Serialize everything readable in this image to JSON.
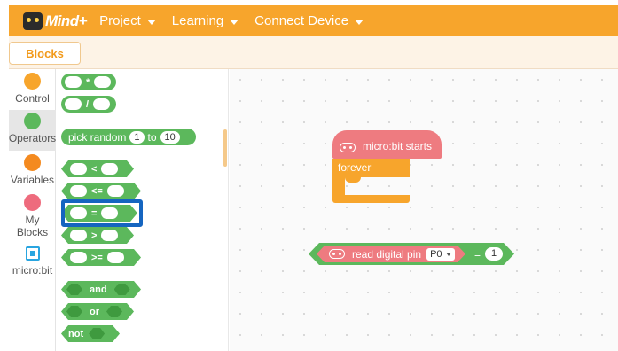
{
  "app": {
    "logo_text": "Mind+",
    "menus": [
      {
        "label": "Project"
      },
      {
        "label": "Learning"
      },
      {
        "label": "Connect Device"
      }
    ],
    "accent_color": "#f7a52c"
  },
  "tabs": {
    "blocks_label": "Blocks"
  },
  "categories": [
    {
      "label": "Control",
      "color": "#f7a52c"
    },
    {
      "label": "Operators",
      "color": "#5cb85c",
      "active": true
    },
    {
      "label": "Variables",
      "color": "#f48a1f"
    },
    {
      "label": "My Blocks",
      "color": "#ee6b7d"
    },
    {
      "label": "micro:bit",
      "icon": "microbit-icon"
    }
  ],
  "palette": {
    "multiply_op": "*",
    "divide_op": "/",
    "pick_random": {
      "label": "pick random",
      "from": "1",
      "to_label": "to",
      "to": "10"
    },
    "lt_op": "<",
    "le_op": "<=",
    "eq_op": "=",
    "gt_op": ">",
    "ge_op": ">=",
    "and_label": "and",
    "or_label": "or",
    "not_label": "not"
  },
  "canvas": {
    "hat_label": "micro:bit starts",
    "forever_label": "forever",
    "read_pin_label": "read digital pin",
    "pin_value": "P0",
    "eq_sign": "=",
    "compare_value": "1"
  }
}
